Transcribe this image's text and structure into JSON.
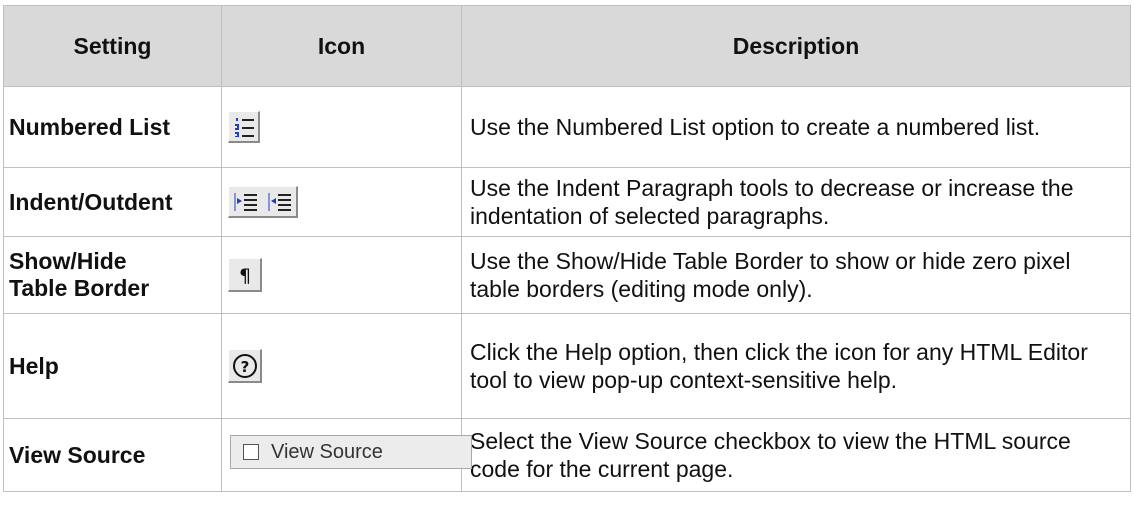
{
  "headers": {
    "setting": "Setting",
    "icon": "Icon",
    "description": "Description"
  },
  "rows": [
    {
      "setting": "Numbered List",
      "icon": "numbered-list-icon",
      "description": "Use the Numbered List option to create a numbered list."
    },
    {
      "setting": "Indent/Outdent",
      "icon": "indent-outdent-icons",
      "description": "Use the Indent Paragraph tools to decrease or increase the indentation of selected paragraphs."
    },
    {
      "setting_line1": "Show/Hide",
      "setting_line2": "Table Border",
      "icon": "pilcrow-icon",
      "description": "Use the Show/Hide Table Border to show or hide zero pixel table borders (editing mode only)."
    },
    {
      "setting": "Help",
      "icon": "help-icon",
      "description": "Click the Help option, then click the icon for any HTML Editor tool to view pop-up context-sensitive help."
    },
    {
      "setting": "View Source",
      "icon": "view-source-checkbox",
      "icon_label": "View Source",
      "description": "Select the View Source checkbox to view the HTML source code for the current page."
    }
  ],
  "colors": {
    "header_bg": "#d9d9d9",
    "border": "#bfbfbf",
    "button_bg": "#e9e9e9",
    "icon_blue": "#1f3fbf"
  }
}
